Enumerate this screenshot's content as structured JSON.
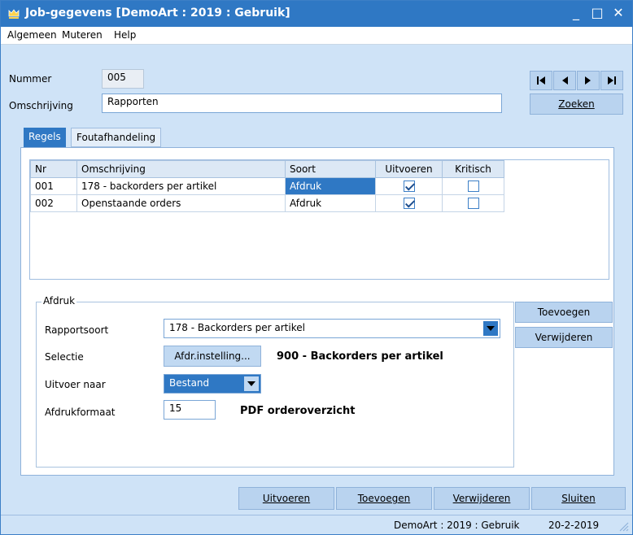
{
  "window": {
    "title": "Job-gegevens [DemoArt : 2019 : Gebruik]",
    "minimize": "_",
    "maximize": "□",
    "close": "✕",
    "accent": "#2f78c4"
  },
  "menu": [
    "Algemeen",
    "Muteren",
    "Help"
  ],
  "header": {
    "nummer_label": "Nummer",
    "nummer_value": "005",
    "omschrijving_label": "Omschrijving",
    "omschrijving_value": "Rapporten",
    "zoeken": "Zoeken",
    "nav_icons": [
      "first-record-icon",
      "previous-record-icon",
      "next-record-icon",
      "last-record-icon"
    ]
  },
  "tabs": [
    "Regels",
    "Foutafhandeling"
  ],
  "grid": {
    "columns": [
      "Nr",
      "Omschrijving",
      "Soort",
      "Uitvoeren",
      "Kritisch"
    ],
    "rows": [
      {
        "nr": "001",
        "omschrijving": "178 - backorders per artikel",
        "soort": "Afdruk",
        "uitvoeren": true,
        "kritisch": false
      },
      {
        "nr": "002",
        "omschrijving": "Openstaande orders",
        "soort": "Afdruk",
        "uitvoeren": true,
        "kritisch": false
      }
    ]
  },
  "afdruk": {
    "group_title": "Afdruk",
    "rapportsoort_label": "Rapportsoort",
    "rapportsoort_value": "178 - Backorders per artikel",
    "selectie_label": "Selectie",
    "selectie_button": "Afdr.instelling...",
    "selectie_desc": "900 - Backorders per artikel",
    "uitvoer_label": "Uitvoer naar",
    "uitvoer_value": "Bestand",
    "afdrukformaat_label": "Afdrukformaat",
    "afdrukformaat_value": "15",
    "afdrukformaat_desc": "PDF orderoverzicht"
  },
  "side_buttons": {
    "toevoegen": "Toevoegen",
    "verwijderen": "Verwijderen"
  },
  "bottom_buttons": {
    "uitvoeren": "Uitvoeren",
    "toevoegen": "Toevoegen",
    "verwijderen": "Verwijderen",
    "sluiten": "Sluiten"
  },
  "status": {
    "context": "DemoArt : 2019 : Gebruik",
    "date": "20-2-2019"
  }
}
